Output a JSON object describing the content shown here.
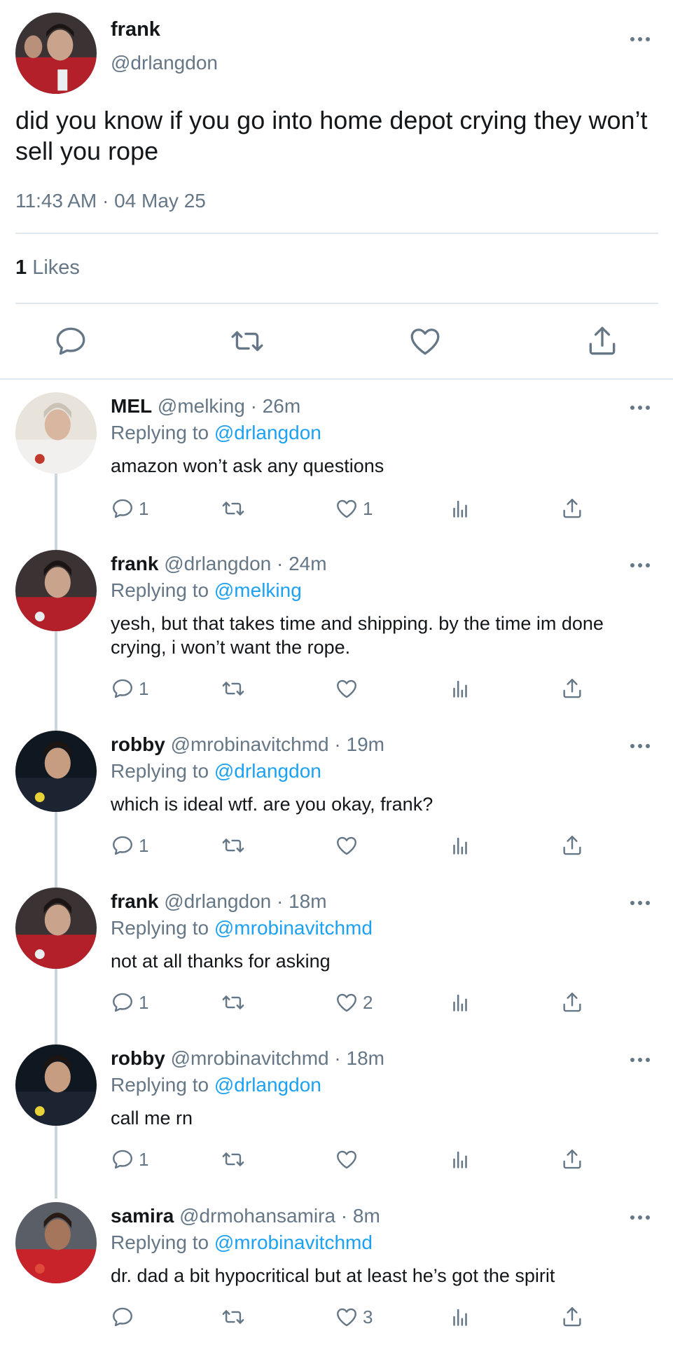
{
  "main_tweet": {
    "name": "frank",
    "handle": "@drlangdon",
    "text": "did you know if you go into home depot crying they won’t sell you rope",
    "timestamp": "11:43 AM · 04 May 25",
    "likes_count": "1",
    "likes_label": "Likes"
  },
  "replies": [
    {
      "name": "MEL",
      "meta": "@melking · 26m",
      "replying_prefix": "Replying to ",
      "replying_to": "@drlangdon",
      "text": "amazon won’t ask any questions",
      "reply_count": "1",
      "retweet_count": "",
      "like_count": "1"
    },
    {
      "name": "frank",
      "meta": "@drlangdon · 24m",
      "replying_prefix": "Replying to ",
      "replying_to": "@melking",
      "text": "yesh, but that takes time and shipping. by the time im done crying, i won’t want the rope.",
      "reply_count": "1",
      "retweet_count": "",
      "like_count": ""
    },
    {
      "name": "robby",
      "meta": "@mrobinavitchmd · 19m",
      "replying_prefix": "Replying to ",
      "replying_to": "@drlangdon",
      "text": "which is ideal wtf. are you okay, frank?",
      "reply_count": "1",
      "retweet_count": "",
      "like_count": ""
    },
    {
      "name": "frank",
      "meta": "@drlangdon · 18m",
      "replying_prefix": "Replying to ",
      "replying_to": "@mrobinavitchmd",
      "text": "not at all thanks for asking",
      "reply_count": "1",
      "retweet_count": "",
      "like_count": "2"
    },
    {
      "name": "robby",
      "meta": "@mrobinavitchmd · 18m",
      "replying_prefix": "Replying to ",
      "replying_to": "@drlangdon",
      "text": "call me rn",
      "reply_count": "1",
      "retweet_count": "",
      "like_count": ""
    },
    {
      "name": "samira",
      "meta": "@drmohansamira · 8m",
      "replying_prefix": "Replying to ",
      "replying_to": "@mrobinavitchmd",
      "text": "dr. dad a bit hypocritical but at least he’s got the spirit",
      "reply_count": "",
      "retweet_count": "",
      "like_count": "3"
    }
  ],
  "icons": {
    "reply": "reply-icon",
    "retweet": "retweet-icon",
    "like": "heart-icon",
    "analytics": "analytics-icon",
    "share": "share-icon",
    "more": "more-icon"
  },
  "colors": {
    "link": "#1da1f2",
    "secondary_text": "#657786",
    "divider": "#e1e8ed",
    "thread_line": "#ccd6dd"
  }
}
